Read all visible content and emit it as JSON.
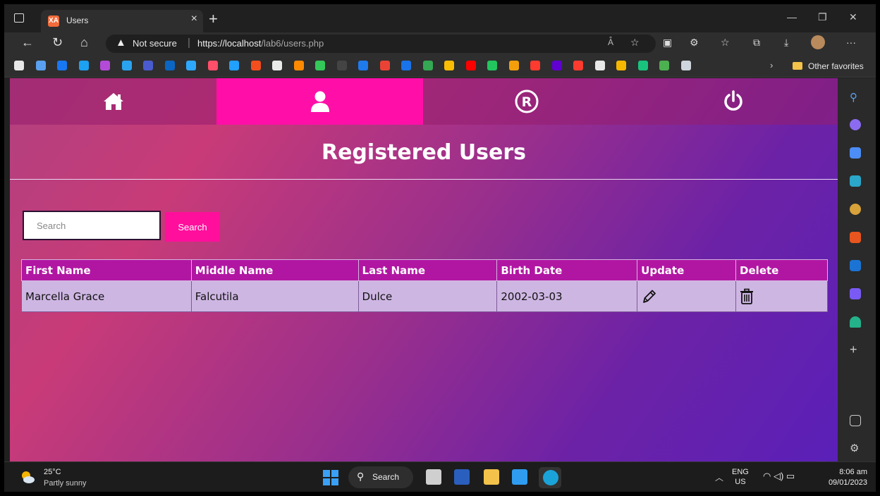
{
  "browser": {
    "tab_title": "Users",
    "tab_favicon": "XA",
    "tab_close": "×",
    "new_tab": "+",
    "not_secure": "Not secure",
    "separator": "|",
    "url_scheme": "https",
    "url_host": "://localhost",
    "url_path": "/lab6/users.php",
    "reader_icon": "A͒",
    "other_favorites": "Other favorites",
    "more": "···"
  },
  "favorites": {
    "colors": [
      "#e8e8e8",
      "#5aa0f0",
      "#1877f2",
      "#1da1f2",
      "#b44bd8",
      "#2aa3ef",
      "#4a5bd0",
      "#0a66c2",
      "#2ea8ff",
      "#ff4f6a",
      "#21a0ff",
      "#f24e1e",
      "#eaeaea",
      "#ff8a00",
      "#34c759",
      "#444",
      "#1f7aec",
      "#ea4335",
      "#1a73e8",
      "#34a853",
      "#fbbc04",
      "#ff0000",
      "#22c55e",
      "#f59e0b",
      "#ff3b30",
      "#6001d2",
      "#ff3b30",
      "#e8e8e8",
      "#f5b700",
      "#19c37d",
      "#4caf50",
      "#cfd6dd"
    ]
  },
  "app": {
    "nav": {
      "home_icon": "home-icon",
      "users_icon": "user-icon",
      "register_icon": "registered-icon",
      "logout_icon": "power-icon",
      "active": "users"
    },
    "title": "Registered Users",
    "search": {
      "placeholder": "Search",
      "button": "Search"
    },
    "table": {
      "columns": [
        "First Name",
        "Middle Name",
        "Last Name",
        "Birth Date",
        "Update",
        "Delete"
      ],
      "rows": [
        {
          "first_name": "Marcella Grace",
          "middle_name": "Falcutila",
          "last_name": "Dulce",
          "birth_date": "2002-03-03",
          "update_icon": "pencil-icon",
          "delete_icon": "trash-icon"
        }
      ]
    }
  },
  "sidebar": {
    "icons": [
      "search-icon",
      "copilot-icon",
      "shopping-icon",
      "tools-icon",
      "people-icon",
      "office-icon",
      "outlook-icon",
      "designer-icon",
      "tree-icon",
      "add-icon",
      "split-screen-icon",
      "settings-icon"
    ]
  },
  "taskbar": {
    "weather_temp": "25°C",
    "weather_desc": "Partly sunny",
    "search_label": "Search",
    "lang_top": "ENG",
    "lang_bottom": "US",
    "time": "8:06 am",
    "date": "09/01/2023"
  },
  "colors": {
    "accent": "#ff0fa8",
    "table_header": "#b116a2",
    "table_row": "#ceb6e3"
  }
}
